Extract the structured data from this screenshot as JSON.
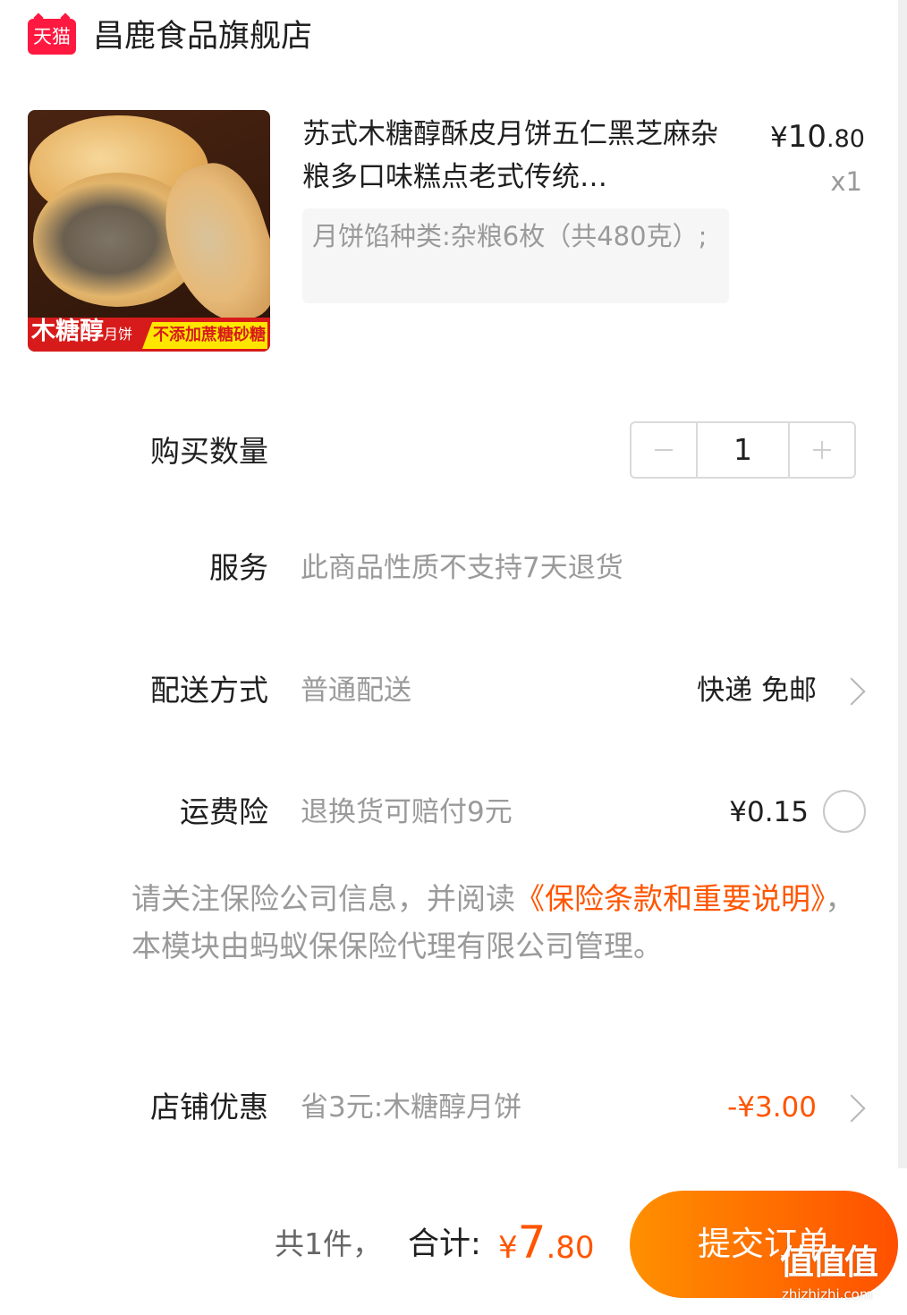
{
  "shop": {
    "badge": "天猫",
    "name": "昌鹿食品旗舰店"
  },
  "product": {
    "image_banner_main": "木糖醇",
    "image_banner_sub": "月饼",
    "image_banner_tag": "不添加蔗糖砂糖",
    "title": "苏式木糖醇酥皮月饼五仁黑芝麻杂粮多口味糕点老式传统…",
    "price_currency": "¥",
    "price_int": "10",
    "price_decimal": ".80",
    "quantity": "x1",
    "sku": "月饼馅种类:杂粮6枚（共480克）;"
  },
  "purchase_quantity": {
    "label": "购买数量",
    "value": "1"
  },
  "service": {
    "label": "服务",
    "value": "此商品性质不支持7天退货"
  },
  "delivery": {
    "label": "配送方式",
    "value": "普通配送",
    "right": "快递 免邮"
  },
  "shipping_insurance": {
    "label": "运费险",
    "value": "退换货可赔付9元",
    "price": "¥0.15"
  },
  "notice": {
    "prefix": "请关注保险公司信息，并阅读",
    "link": "《保险条款和重要说明》",
    "suffix": "，本模块由蚂蚁保保险代理有限公司管理。"
  },
  "shop_discount": {
    "label": "店铺优惠",
    "value": "省3元:木糖醇月饼",
    "amount": "-¥3.00"
  },
  "footer": {
    "count": "共1件，",
    "total_label": "合计:",
    "total_currency": "¥",
    "total_int": "7",
    "total_decimal": ".80",
    "submit": "提交订单"
  },
  "watermark": {
    "mark": "值值值",
    "url": "zhizhizhi.com"
  },
  "colors": {
    "accent": "#ff5500",
    "tmall": "#ff1940",
    "button_start": "#ff9000",
    "button_end": "#ff5000"
  },
  "icons": [
    "tmall-logo-icon",
    "minus-icon",
    "plus-icon",
    "chevron-right-icon",
    "radio-icon"
  ]
}
